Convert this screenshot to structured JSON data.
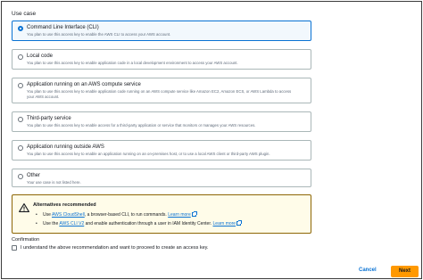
{
  "use_case": {
    "label": "Use case",
    "options": [
      {
        "title": "Command Line Interface (CLI)",
        "description": "You plan to use this access key to enable the AWS CLI to access your AWS account.",
        "selected": true
      },
      {
        "title": "Local code",
        "description": "You plan to use this access key to enable application code in a local development environment to access your AWS account.",
        "selected": false
      },
      {
        "title": "Application running on an AWS compute service",
        "description": "You plan to use this access key to enable application code running on an AWS compute service like Amazon EC2, Amazon ECS, or AWS Lambda to access your AWS account.",
        "selected": false
      },
      {
        "title": "Third-party service",
        "description": "You plan to use this access key to enable access for a third-party application or service that monitors or manages your AWS resources.",
        "selected": false
      },
      {
        "title": "Application running outside AWS",
        "description": "You plan to use this access key to enable an application running on an on-premises host, or to use a local AWS client or third-party AWS plugin.",
        "selected": false
      },
      {
        "title": "Other",
        "description": "Your use case is not listed here.",
        "selected": false
      }
    ]
  },
  "alert": {
    "title": "Alternatives recommended",
    "line1_prefix": "Use ",
    "line1_link": "AWS CloudShell",
    "line1_suffix": ", a browser-based CLI, to run commands.",
    "line1_learn": "Learn more",
    "line2_prefix": "Use the ",
    "line2_link": "AWS CLI V2",
    "line2_suffix": " and enable authentication through a user in IAM Identity Center.",
    "line2_learn": "Learn more"
  },
  "confirmation": {
    "label": "Confirmation",
    "checkbox_text": "I understand the above recommendation and want to proceed to create an access key.",
    "checked": false
  },
  "footer": {
    "cancel_label": "Cancel",
    "next_label": "Next"
  },
  "colors": {
    "accent": "#0972d3",
    "primary_button": "#ff9900",
    "warning_border": "#8d6605",
    "warning_bg": "#fffce9"
  }
}
